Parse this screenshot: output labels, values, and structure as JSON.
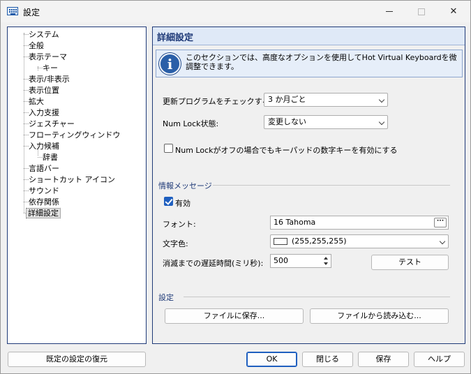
{
  "window": {
    "title": "設定"
  },
  "icons": {
    "app": "keyboard-icon",
    "info": "info-icon",
    "close": "close-icon",
    "minimize": "minimize-icon",
    "maximize": "maximize-icon"
  },
  "titlebar": {
    "close_glyph": "✕"
  },
  "tree": {
    "items": [
      {
        "label": "システム"
      },
      {
        "label": "全般"
      },
      {
        "label": "表示テーマ"
      },
      {
        "label": "キー"
      },
      {
        "label": "表示/非表示"
      },
      {
        "label": "表示位置"
      },
      {
        "label": "拡大"
      },
      {
        "label": "入力支援"
      },
      {
        "label": "ジェスチャー"
      },
      {
        "label": "フローティングウィンドウ"
      },
      {
        "label": "入力候補"
      },
      {
        "label": "辞書"
      },
      {
        "label": "言語バー"
      },
      {
        "label": "ショートカット アイコン"
      },
      {
        "label": "サウンド"
      },
      {
        "label": "依存関係"
      },
      {
        "label": "詳細設定"
      }
    ],
    "selected": "詳細設定"
  },
  "panel": {
    "title": "詳細設定",
    "info": "このセクションでは、高度なオプションを使用してHot Virtual Keyboardを微調整できます。",
    "update_label": "更新プログラムをチェックする:",
    "update_value": "3 か月ごと",
    "numlock_label": "Num Lock状態:",
    "numlock_value": "変更しない",
    "numpad_checkbox": "Num Lockがオフの場合でもキーパッドの数字キーを有効にする",
    "numpad_checked": false,
    "info_group": "情報メッセージ",
    "enabled_label": "有効",
    "enabled_checked": true,
    "font_label": "フォント:",
    "font_value": "16 Tahoma",
    "ellipsis": "···",
    "color_label": "文字色:",
    "color_value": "(255,255,255)",
    "color_swatch": "#ffffff",
    "delay_label": "消滅までの遅延時間(ミリ秒):",
    "delay_value": "500",
    "test_button": "テスト",
    "settings_group": "設定",
    "save_file_button": "ファイルに保存...",
    "load_file_button": "ファイルから読み込む..."
  },
  "footer": {
    "restore_button": "既定の設定の復元",
    "ok_button": "OK",
    "close_button": "閉じる",
    "save_button": "保存",
    "help_button": "ヘルプ"
  },
  "colors": {
    "accent": "#1f5fbf",
    "header_bg": "#dfe9f7",
    "border": "#1f3a78"
  }
}
